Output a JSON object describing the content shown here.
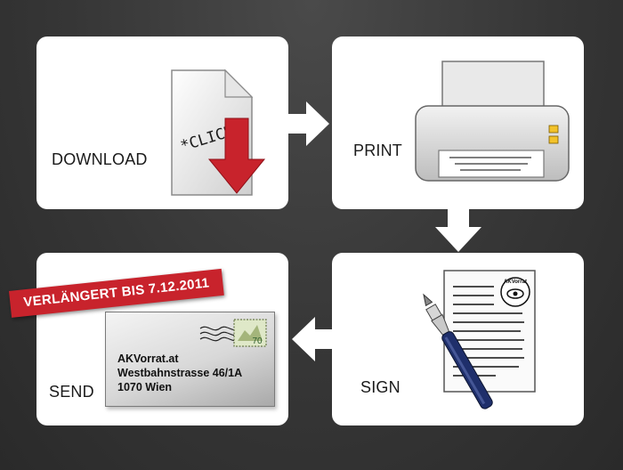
{
  "steps": {
    "download": {
      "label": "DOWNLOAD",
      "click_text": "*CLICK*"
    },
    "print": {
      "label": "PRINT"
    },
    "sign": {
      "label": "SIGN",
      "logo_text": "AKVorrat"
    },
    "send": {
      "label": "SEND",
      "address": [
        "AKVorrat.at",
        "Westbahnstrasse 46/1A",
        "1070 Wien"
      ],
      "stamp_value": "70"
    }
  },
  "banner": {
    "text": "VERLÄNGERT BIS 7.12.2011"
  },
  "colors": {
    "background": "#363636",
    "card": "#ffffff",
    "arrow": "#ffffff",
    "download_arrow": "#c8232c",
    "banner": "#c8232c",
    "printer_led": "#f2c22a",
    "pen_body": "#1f2f6b"
  },
  "icons": [
    "document-click-icon",
    "download-arrow-icon",
    "printer-icon",
    "signed-document-icon",
    "fountain-pen-icon",
    "envelope-icon",
    "stamp-icon"
  ]
}
